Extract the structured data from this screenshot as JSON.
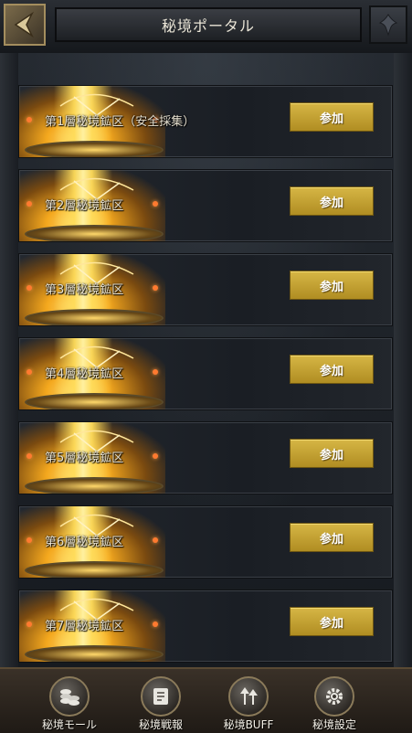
{
  "header": {
    "title": "秘境ポータル",
    "back_icon": "chevron-left-icon",
    "ornament_icon": "fleur-icon"
  },
  "levels": [
    {
      "label": "第1層秘境鉱区（安全採集）",
      "button": "参加"
    },
    {
      "label": "第2層秘境鉱区",
      "button": "参加"
    },
    {
      "label": "第3層秘境鉱区",
      "button": "参加"
    },
    {
      "label": "第4層秘境鉱区",
      "button": "参加"
    },
    {
      "label": "第5層秘境鉱区",
      "button": "参加"
    },
    {
      "label": "第6層秘境鉱区",
      "button": "参加"
    },
    {
      "label": "第7層秘境鉱区",
      "button": "参加"
    }
  ],
  "bottom_nav": [
    {
      "label": "秘境モール",
      "icon": "coins-icon"
    },
    {
      "label": "秘境戦報",
      "icon": "scroll-icon"
    },
    {
      "label": "秘境BUFF",
      "icon": "arrows-up-icon"
    },
    {
      "label": "秘境設定",
      "icon": "gear-icon"
    }
  ],
  "colors": {
    "accent_gold": "#c9a832",
    "background": "#1b2027",
    "text": "#e6e0d0"
  }
}
